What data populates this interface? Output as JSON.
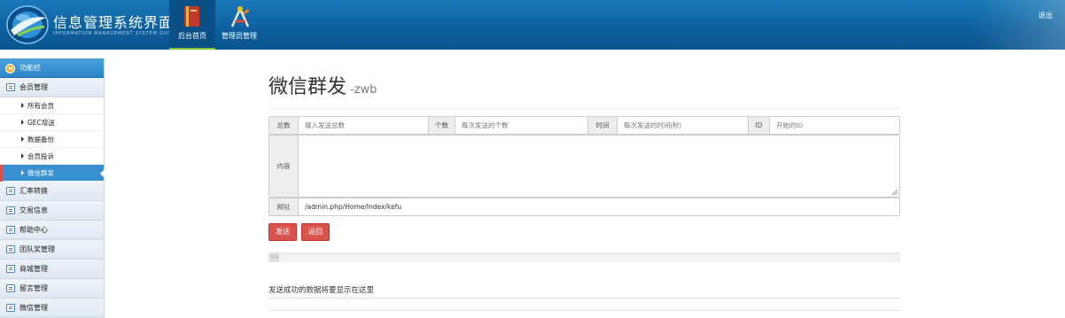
{
  "header": {
    "title": "信息管理系统界面",
    "subtitle": "INFORMATION MANAGEMENT SYSTEM GUI",
    "nav": [
      {
        "label": "后台首页",
        "icon": "book-icon",
        "active": true
      },
      {
        "label": "管理员管理",
        "icon": "tools-icon",
        "active": false
      }
    ],
    "logout": "退出"
  },
  "sidebar": {
    "header": "功能栏",
    "groups": [
      {
        "label": "会员管理",
        "icon": "list-icon"
      },
      {
        "label": "汇率转换",
        "icon": "chat-icon"
      },
      {
        "label": "交易信息",
        "icon": "list-icon"
      },
      {
        "label": "帮助中心",
        "icon": "edit-icon"
      },
      {
        "label": "团队奖管理",
        "icon": "list-icon"
      },
      {
        "label": "商城管理",
        "icon": "calendar-icon"
      },
      {
        "label": "留言管理",
        "icon": "edit-icon"
      },
      {
        "label": "微信管理",
        "icon": "list-icon"
      }
    ],
    "member_items": [
      {
        "label": "所有会员"
      },
      {
        "label": "GEC增送"
      },
      {
        "label": "数据备份"
      },
      {
        "label": "会员投诉"
      },
      {
        "label": "微信群发",
        "active": true
      }
    ]
  },
  "main": {
    "title": "微信群发",
    "title_suffix": "-zwb",
    "fields": {
      "total_label": "总数",
      "total_placeholder": "输入发送总数",
      "count_label": "个数",
      "count_placeholder": "每次发送的个数",
      "time_label": "时间",
      "time_placeholder": "每次发送的时间(秒)",
      "id_label": "ID",
      "id_placeholder": "开始的ID",
      "content_label": "内容",
      "url_label": "网址",
      "url_value": "/admin.php/Home/Index/kefu"
    },
    "buttons": {
      "send": "发送",
      "back": "返回"
    },
    "progress": {
      "value": 0,
      "text": "0%"
    },
    "result_text": "发送成功的数据将要显示在这里"
  },
  "colors": {
    "header": "#0d5f9c",
    "accent": "#3a8fd1",
    "danger": "#d9534f",
    "nav_active_bar": "#7ec230"
  }
}
